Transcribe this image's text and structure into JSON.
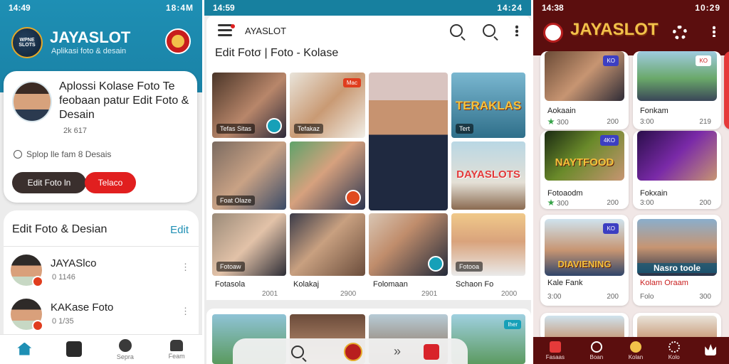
{
  "panel1": {
    "status_time": "14:49",
    "status_right": "18:4M",
    "brand": "JAYASLOT",
    "subtitle": "Aplikasi foto & desain",
    "logo_text": "WPNE SLOTS",
    "card": {
      "title": "Aplossi Kolase Foto Te feobaan patur Edit Foto & Desain",
      "meta": "2k 617",
      "line": "Splop lle fam 8 Desais",
      "btn_primary": "Edit Foto ln",
      "btn_secondary": "Telaco"
    },
    "list": {
      "header": "Edit Foto & Desian",
      "edit": "Edit",
      "items": [
        {
          "title": "JAYASlco",
          "sub": "0 1146"
        },
        {
          "title": "KAKase Foto",
          "sub": "0 1/35"
        }
      ]
    },
    "nav": [
      {
        "label": "",
        "icon": "home-icon"
      },
      {
        "label": "",
        "icon": "gallery-icon"
      },
      {
        "label": "Sepra",
        "icon": "explore-icon"
      },
      {
        "label": "Feam",
        "icon": "profile-icon"
      }
    ]
  },
  "panel2": {
    "status_time": "14:59",
    "status_right": "14:24",
    "brand": "AYASLOT",
    "title": "Edit Fotσ | Foto - Kolase",
    "tiles": [
      {
        "label": "Tefas Sitas",
        "pill": ""
      },
      {
        "label": "Tefakaz",
        "pill": "Mac"
      },
      {
        "label": "",
        "pill": ""
      },
      {
        "label": "Tert",
        "pill": "",
        "big": "TERAKLAS"
      },
      {
        "label": "Foat Olaze",
        "pill": ""
      },
      {
        "label": "",
        "pill": ""
      },
      {
        "label": "",
        "pill": "",
        "big": "DAYASLOTS"
      },
      {
        "label": "Fotoaw",
        "pill": ""
      },
      {
        "label": "",
        "pill": ""
      },
      {
        "label": "",
        "pill": ""
      },
      {
        "label": "Fotooa",
        "pill": ""
      }
    ],
    "captions": [
      {
        "name": "Fotasola",
        "num": "2001"
      },
      {
        "name": "Kolakaj",
        "num": "2900"
      },
      {
        "name": "Folomaan",
        "num": "2901"
      },
      {
        "name": "Schaon Fo",
        "num": "2000"
      }
    ],
    "bottom_badge": "Iher"
  },
  "panel3": {
    "status_time": "14:38",
    "status_right": "10:29",
    "brand": "JAYASLOT",
    "cards": [
      {
        "name": "Aokaain",
        "meta": "300",
        "views": "200",
        "badge": "KO"
      },
      {
        "name": "Fonkam",
        "meta": "3:00",
        "views": "219",
        "badge": "KO"
      },
      {
        "name": "Fotoaodm",
        "meta": "300",
        "views": "200",
        "badge": "4KO",
        "big": "NAYTFOOD"
      },
      {
        "name": "Fokxain",
        "meta": "3:00",
        "views": "200",
        "badge": ""
      },
      {
        "name": "Kale Fank",
        "meta": "3:00",
        "views": "200",
        "badge": "KO",
        "big": "DIAVIENING"
      },
      {
        "name": "Kolam Oraam",
        "meta": "Folo",
        "views": "300",
        "badge": "",
        "big": "Nasro toole"
      }
    ],
    "nav": [
      {
        "label": "Fasaas",
        "icon": "flag-icon"
      },
      {
        "label": "Boan",
        "icon": "search-icon"
      },
      {
        "label": "Kolan",
        "icon": "avatar-icon"
      },
      {
        "label": "Kolo",
        "icon": "gear-icon"
      },
      {
        "label": "",
        "icon": "crown-icon"
      }
    ]
  }
}
